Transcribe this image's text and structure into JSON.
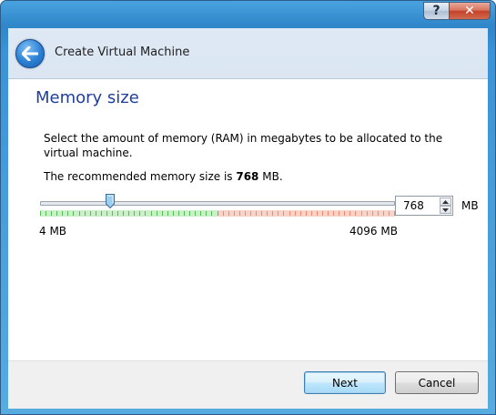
{
  "window": {
    "help_label": "?",
    "close_label": "✕",
    "title": "Create Virtual Machine"
  },
  "page": {
    "heading": "Memory size",
    "description": "Select the amount of memory (RAM) in megabytes to be allocated to the virtual machine.",
    "recommend_prefix": "The recommended memory size is ",
    "recommend_value": "768",
    "recommend_suffix": " MB."
  },
  "memory": {
    "value": "768",
    "unit": "MB",
    "range_min_label": "4 MB",
    "range_max_label": "4096 MB",
    "min": 4,
    "max": 4096,
    "current": 768,
    "colors": {
      "safe": "#7ed67e",
      "warning": "#f2a08a",
      "thumb": "#9ccfee"
    }
  },
  "buttons": {
    "next_label": "Next",
    "cancel_label": "Cancel"
  }
}
